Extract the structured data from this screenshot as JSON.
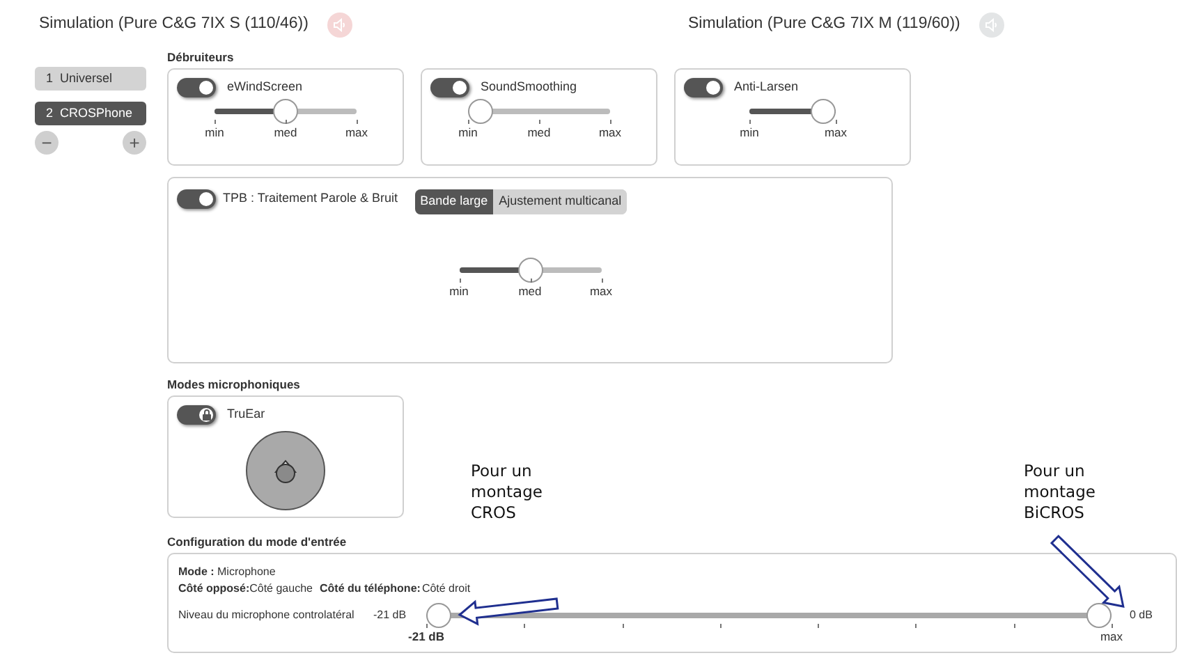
{
  "simulations": [
    {
      "title": "Simulation (Pure C&G 7IX S (110/46))",
      "color": "#f5d6d6"
    },
    {
      "title": "Simulation (Pure C&G 7IX M (119/60))",
      "color": "#e3e5e6"
    }
  ],
  "programs": [
    {
      "number": "1",
      "label": "Universel",
      "selected": false
    },
    {
      "number": "2",
      "label": "CROSPhone",
      "selected": true
    }
  ],
  "program_controls": {
    "remove": "−",
    "add": "+"
  },
  "noise_reducers": {
    "title": "Débruiteurs",
    "items": [
      {
        "label": "eWindScreen",
        "on": true,
        "level": 0.5,
        "ticks": [
          "min",
          "med",
          "max"
        ]
      },
      {
        "label": "SoundSmoothing",
        "on": true,
        "level": 0,
        "ticks": [
          "min",
          "med",
          "max"
        ]
      },
      {
        "label": "Anti-Larsen",
        "on": true,
        "level": 1,
        "ticks": [
          "min",
          "max"
        ]
      }
    ]
  },
  "tpb": {
    "label": "TPB : Traitement Parole & Bruit",
    "on": true,
    "tabs": [
      {
        "label": "Bande large",
        "selected": true
      },
      {
        "label": "Ajustement multicanal",
        "selected": false
      }
    ],
    "level": 0.5,
    "ticks": [
      "min",
      "med",
      "max"
    ]
  },
  "mic_modes": {
    "title": "Modes microphoniques",
    "label": "TruEar",
    "on": true,
    "locked": true
  },
  "input_config": {
    "title": "Configuration du mode d'entrée",
    "mode_label": "Mode :",
    "mode_value": "Microphone",
    "opposite_label": "Côté opposé:",
    "opposite_value": "Côté gauche",
    "phone_label": "Côté du téléphone:",
    "phone_value": "Côté droit",
    "slider_label": "Niveau du microphone controlatéral",
    "min_reading": "-21 dB",
    "max_reading": "0 dB",
    "thumbs": [
      {
        "level": 0
      },
      {
        "level": 1
      }
    ],
    "start_tick": "-21 dB",
    "end_tick": "max"
  },
  "annotations": [
    {
      "text": "Pour un montage CROS"
    },
    {
      "text": "Pour un montage BiCROS"
    }
  ]
}
